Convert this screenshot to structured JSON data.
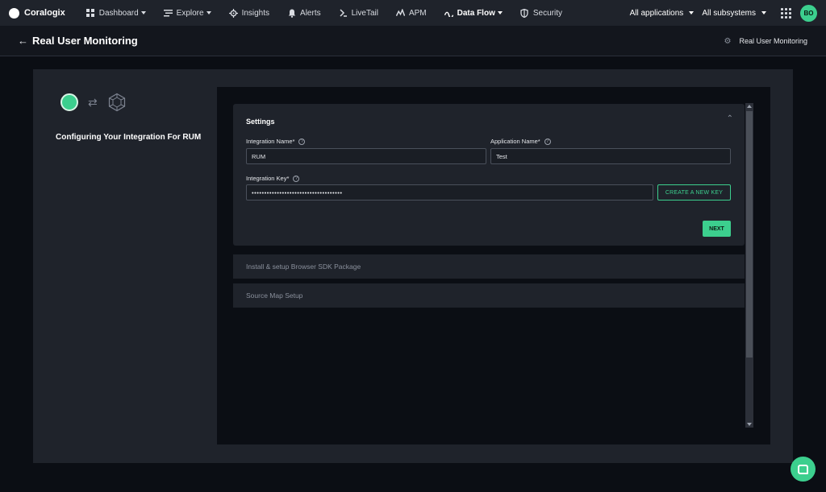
{
  "brand": {
    "name": "Coralogix"
  },
  "nav": {
    "items": [
      {
        "label": "Dashboard",
        "icon": "dashboard-icon",
        "dropdown": true
      },
      {
        "label": "Explore",
        "icon": "explore-icon",
        "dropdown": true
      },
      {
        "label": "Insights",
        "icon": "insights-icon",
        "dropdown": false
      },
      {
        "label": "Alerts",
        "icon": "bell-icon",
        "dropdown": false
      },
      {
        "label": "LiveTail",
        "icon": "livetail-icon",
        "dropdown": false
      },
      {
        "label": "APM",
        "icon": "apm-icon",
        "dropdown": false
      },
      {
        "label": "Data Flow",
        "icon": "dataflow-icon",
        "dropdown": true
      },
      {
        "label": "Security",
        "icon": "shield-icon",
        "dropdown": false
      }
    ],
    "applications": "All applications",
    "subsystems": "All subsystems",
    "avatar": "BO"
  },
  "header": {
    "title": "Real User Monitoring",
    "right_label": "Real User Monitoring"
  },
  "wizard": {
    "title": "Configuring Your Integration For RUM"
  },
  "settings": {
    "title": "Settings",
    "integration_name_label": "Integration Name*",
    "integration_name_value": "RUM",
    "application_name_label": "Application Name*",
    "application_name_value": "Test",
    "integration_key_label": "Integration Key*",
    "integration_key_value": "••••••••••••••••••••••••••••••••••••",
    "create_key_label": "CREATE A NEW KEY",
    "next_label": "NEXT"
  },
  "sections": [
    {
      "label": "Install & setup Browser SDK Package"
    },
    {
      "label": "Source Map Setup"
    }
  ],
  "colors": {
    "accent": "#3ccf8e",
    "topbar": "#1f232b",
    "background": "#0b0e14"
  }
}
